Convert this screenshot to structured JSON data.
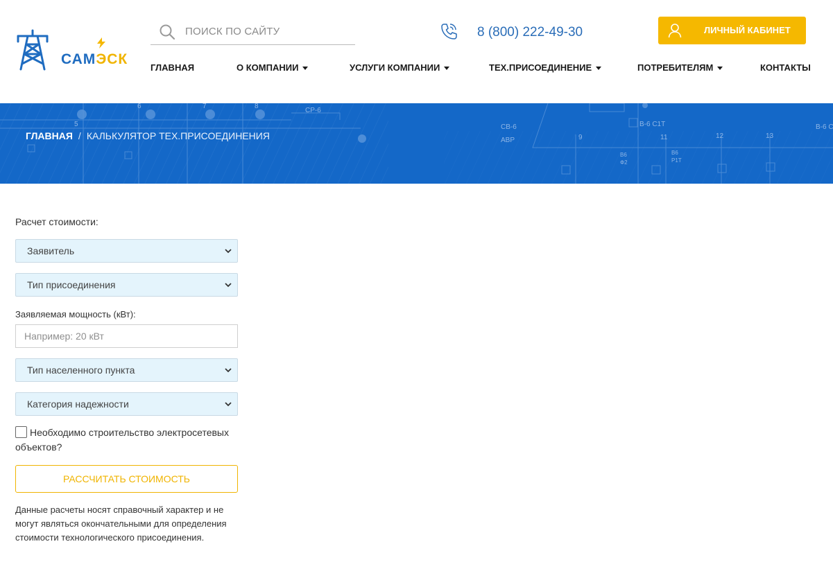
{
  "logo": {
    "part1": "САМ",
    "part2": "ЭСК"
  },
  "search": {
    "placeholder": "ПОИСК ПО САЙТУ"
  },
  "phone": "8 (800) 222-49-30",
  "cabinet": {
    "label": "ЛИЧНЫЙ КАБИНЕТ"
  },
  "nav": {
    "items": [
      {
        "label": "ГЛАВНАЯ"
      },
      {
        "label": "О КОМПАНИИ"
      },
      {
        "label": "УСЛУГИ КОМПАНИИ"
      },
      {
        "label": "ТЕХ.ПРИСОЕДИНЕНИЕ"
      },
      {
        "label": "ПОТРЕБИТЕЛЯМ"
      },
      {
        "label": "КОНТАКТЫ"
      }
    ]
  },
  "breadcrumb": {
    "home": "ГЛАВНАЯ",
    "separator": "/",
    "current": "КАЛЬКУЛЯТОР ТЕХ.ПРИСОЕДИНЕНИЯ"
  },
  "banner": {
    "labels": [
      "СР-6",
      "СВ-6",
      "АВР",
      "В-6 С1Т",
      "В-6 С",
      "5",
      "6",
      "7",
      "8",
      "9",
      "11",
      "12",
      "13",
      "В6",
      "Ф2",
      "В6",
      "Р1Т"
    ]
  },
  "form": {
    "title": "Расчет стоимости:",
    "applicant": "Заявитель",
    "connection_type": "Тип присоединения",
    "power_label": "Заявляемая мощность (кВт):",
    "power_placeholder": "Например: 20 кВт",
    "settlement_type": "Тип населенного пункта",
    "reliability": "Категория надежности",
    "checkbox_label": "Необходимо строительство электросетевых объектов?",
    "submit": "РАССЧИТАТЬ СТОИМОСТЬ",
    "note": "Данные расчеты носят справочный характер и не могут являться окончательными для определения стоимости технологического присоединения."
  },
  "colors": {
    "brand_blue": "#1468c8",
    "accent_yellow": "#f5b800",
    "select_bg": "#e4f4fc"
  }
}
